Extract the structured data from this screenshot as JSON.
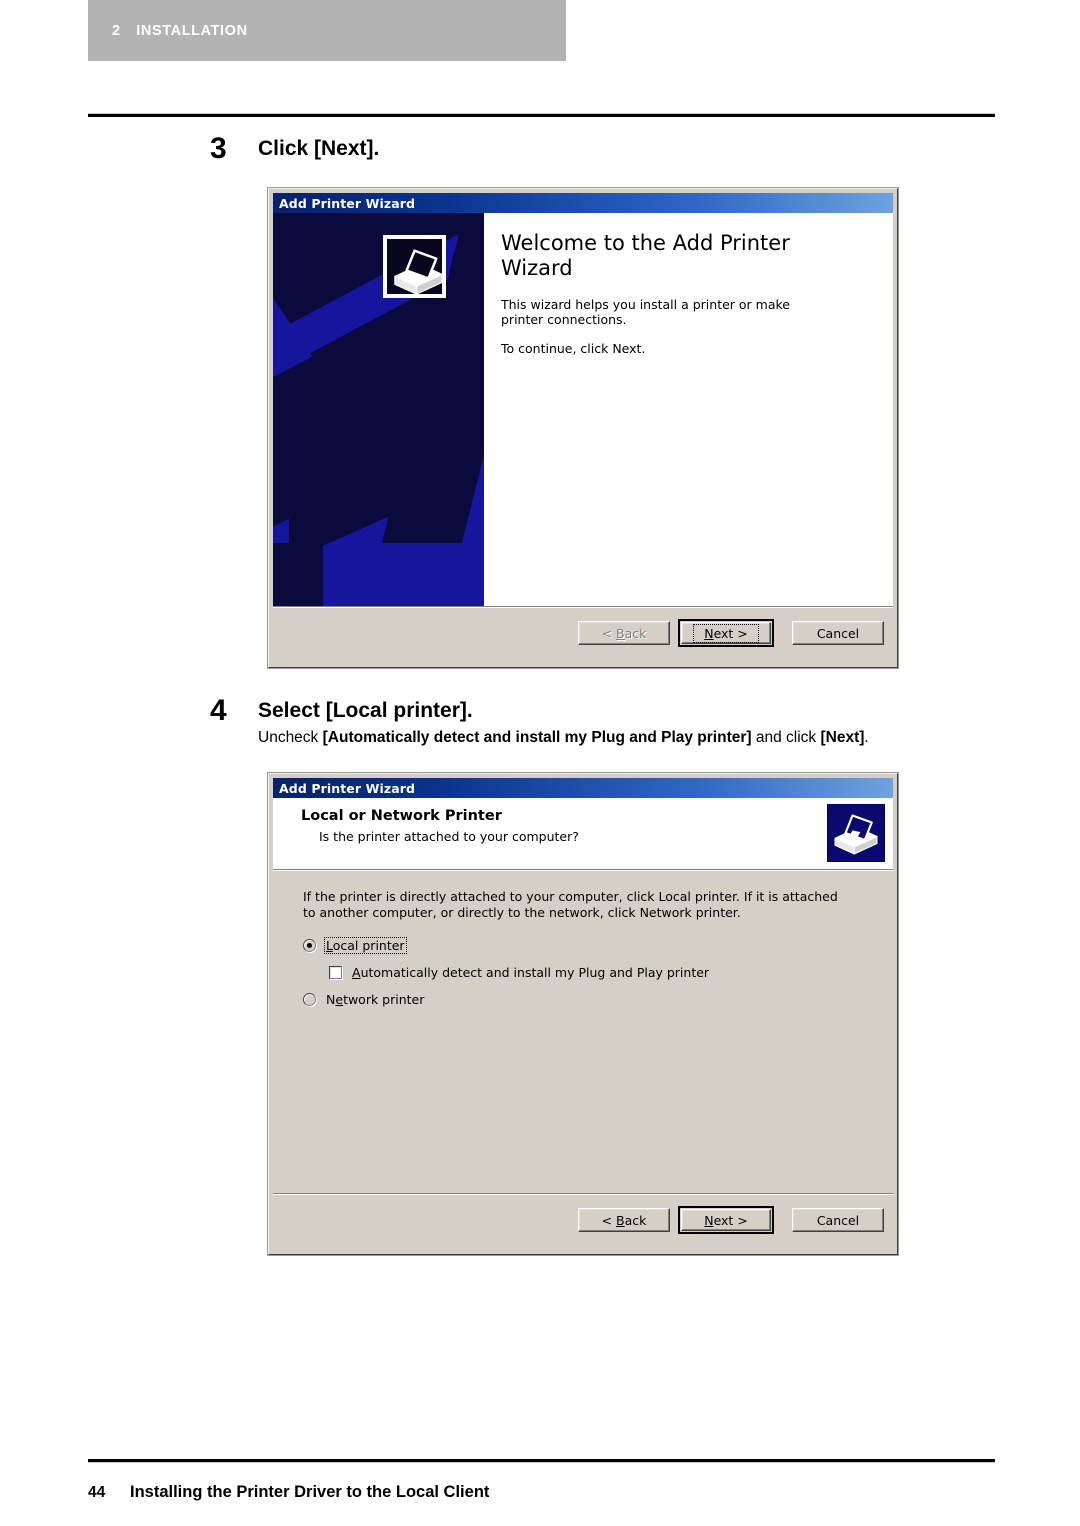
{
  "page": {
    "chapter_number": "2",
    "chapter_name": "INSTALLATION",
    "page_number": "44",
    "footer_title": "Installing the Printer Driver to the Local Client"
  },
  "steps": [
    {
      "number": "3",
      "title": "Click [Next]."
    },
    {
      "number": "4",
      "title": "Select [Local printer].",
      "sub_prefix": "Uncheck ",
      "sub_bold1": "[Automatically detect and install my Plug and Play printer]",
      "sub_mid": " and click ",
      "sub_bold2": "[Next]",
      "sub_suffix": "."
    }
  ],
  "dialog1": {
    "title": "Add Printer Wizard",
    "heading": "Welcome to the Add Printer Wizard",
    "paragraph1": "This wizard helps you install a printer or make printer connections.",
    "paragraph2": "To continue, click Next.",
    "buttons": {
      "back_pre": "< ",
      "back_acc": "B",
      "back_post": "ack",
      "next_acc": "N",
      "next_post": "ext >",
      "cancel": "Cancel"
    },
    "icon_name": "printer-icon"
  },
  "dialog2": {
    "title": "Add Printer Wizard",
    "heading": "Local or Network Printer",
    "subheading": "Is the printer attached to your computer?",
    "paragraph": "If the printer is directly attached to your computer, click Local printer.  If it is attached to another computer, or directly to the network, click Network printer.",
    "options": {
      "local_acc": "L",
      "local_post": "ocal printer",
      "auto_acc": "A",
      "auto_post": "utomatically detect and install my Plug and Play printer",
      "network_pre": "N",
      "network_acc": "e",
      "network_post": "twork printer"
    },
    "buttons": {
      "back_pre": "< ",
      "back_acc": "B",
      "back_post": "ack",
      "next_acc": "N",
      "next_post": "ext >",
      "cancel": "Cancel"
    },
    "icon_name": "printer-icon"
  },
  "colors": {
    "band_gray": "#b3b3b3",
    "dialog_face": "#d4d0c8",
    "title_blue_dark": "#08216b",
    "title_blue_light": "#6ea2e0",
    "banner_navy": "#0a0a3c",
    "banner_blue": "#15159e"
  }
}
